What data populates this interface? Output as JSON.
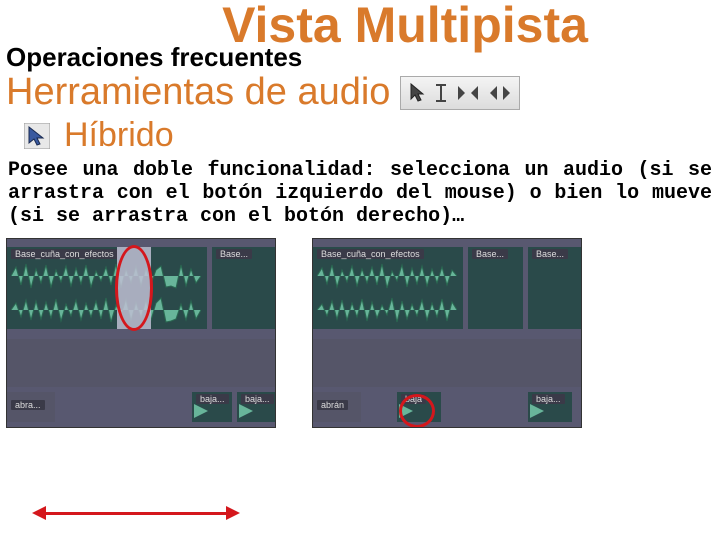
{
  "title": "Vista Multipista",
  "subtitle": "Operaciones frecuentes",
  "section": "Herramientas de audio",
  "tool_name": "Híbrido",
  "body": "Posee una doble funcionalidad: selecciona un audio (si se arrastra con el botón izquierdo del mouse) o bien lo mueve (si se arrastra con el botón derecho)…",
  "tracks": {
    "main": "Base_cuña_con_efectos",
    "aux1": "Base...",
    "aux2": "Base...",
    "low1": "abra...",
    "low2": "baja...",
    "low3": "baja...",
    "s_low1": "abrán",
    "s_low2": "baja",
    "s_low3": "baja..."
  },
  "icons": {
    "cursor": "cursor-icon",
    "ibeam": "ibeam-icon",
    "move_in": "move-in-icon",
    "move_out": "move-out-icon"
  }
}
